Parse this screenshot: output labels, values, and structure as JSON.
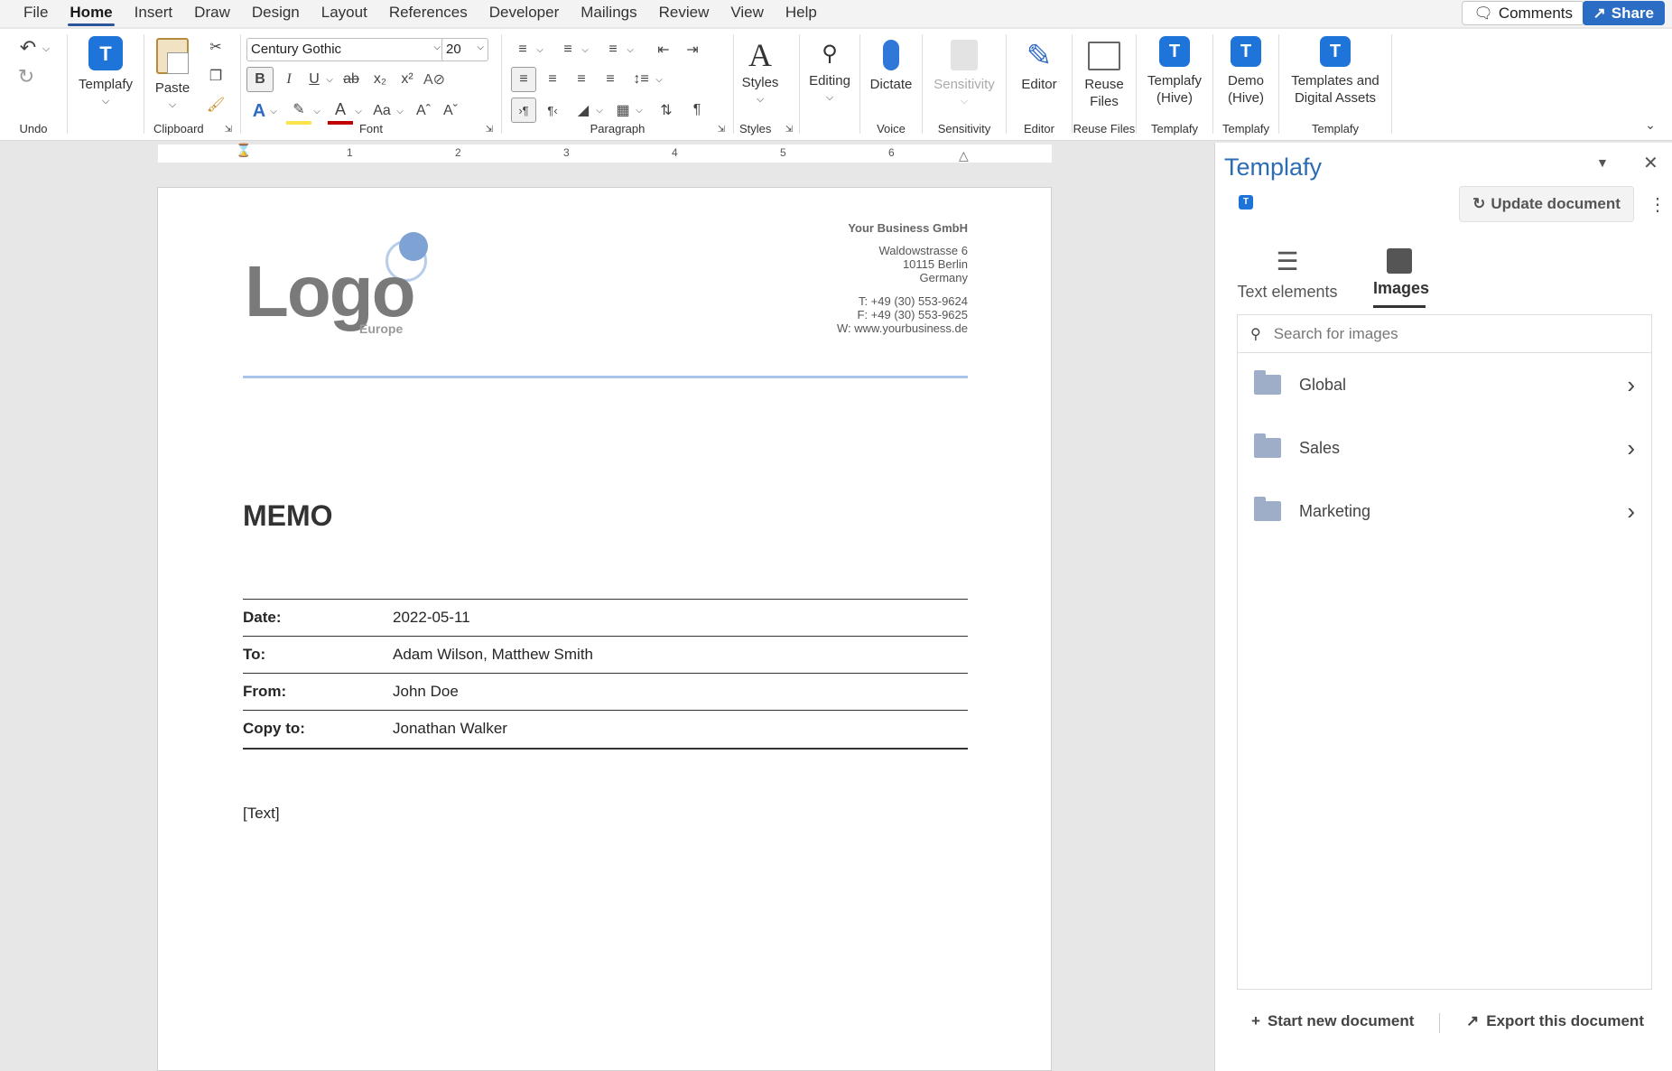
{
  "menu": {
    "items": [
      "File",
      "Home",
      "Insert",
      "Draw",
      "Design",
      "Layout",
      "References",
      "Developer",
      "Mailings",
      "Review",
      "View",
      "Help"
    ],
    "comments": "Comments",
    "share": "Share"
  },
  "ribbon": {
    "undo_label": "Undo",
    "templafy_label": "Templafy",
    "paste_label": "Paste",
    "clipboard_label": "Clipboard",
    "font_name": "Century Gothic",
    "font_size": "20",
    "font_label": "Font",
    "paragraph_label": "Paragraph",
    "styles_btn": "Styles",
    "styles_label": "Styles",
    "editing_btn": "Editing",
    "dictate_btn": "Dictate",
    "voice_label": "Voice",
    "sensitivity_btn": "Sensitivity",
    "sensitivity_label": "Sensitivity",
    "editor_btn": "Editor",
    "editor_label": "Editor",
    "reuse_btn1": "Reuse",
    "reuse_btn2": "Files",
    "reuse_label": "Reuse Files",
    "templafy_hive1": "Templafy",
    "templafy_hive2": "(Hive)",
    "templafy_group_label": "Templafy",
    "demo_hive1": "Demo",
    "demo_hive2": "(Hive)",
    "tda1": "Templates and",
    "tda2": "Digital Assets"
  },
  "ruler": [
    "1",
    "2",
    "3",
    "4",
    "5",
    "6"
  ],
  "document": {
    "logo": "Logo",
    "logo_sub": "Europe",
    "company": "Your Business GmbH",
    "street": "Waldowstrasse 6",
    "city": "10115 Berlin",
    "country": "Germany",
    "tel": "T: +49 (30) 553-9624",
    "fax": "F: +49 (30) 553-9625",
    "web": "W: www.yourbusiness.de",
    "title": "MEMO",
    "rows": [
      {
        "k": "Date:",
        "v": "2022-05-11"
      },
      {
        "k": "To:",
        "v": "Adam Wilson, Matthew Smith"
      },
      {
        "k": "From:",
        "v": "John Doe"
      },
      {
        "k": "Copy to:",
        "v": "Jonathan Walker"
      }
    ],
    "body": "[Text]"
  },
  "pane": {
    "title": "Templafy",
    "update": "Update document",
    "tab_text": "Text elements",
    "tab_images": "Images",
    "search_placeholder": "Search for images",
    "folders": [
      "Global",
      "Sales",
      "Marketing"
    ],
    "start_new": "Start new document",
    "export": "Export this document"
  }
}
